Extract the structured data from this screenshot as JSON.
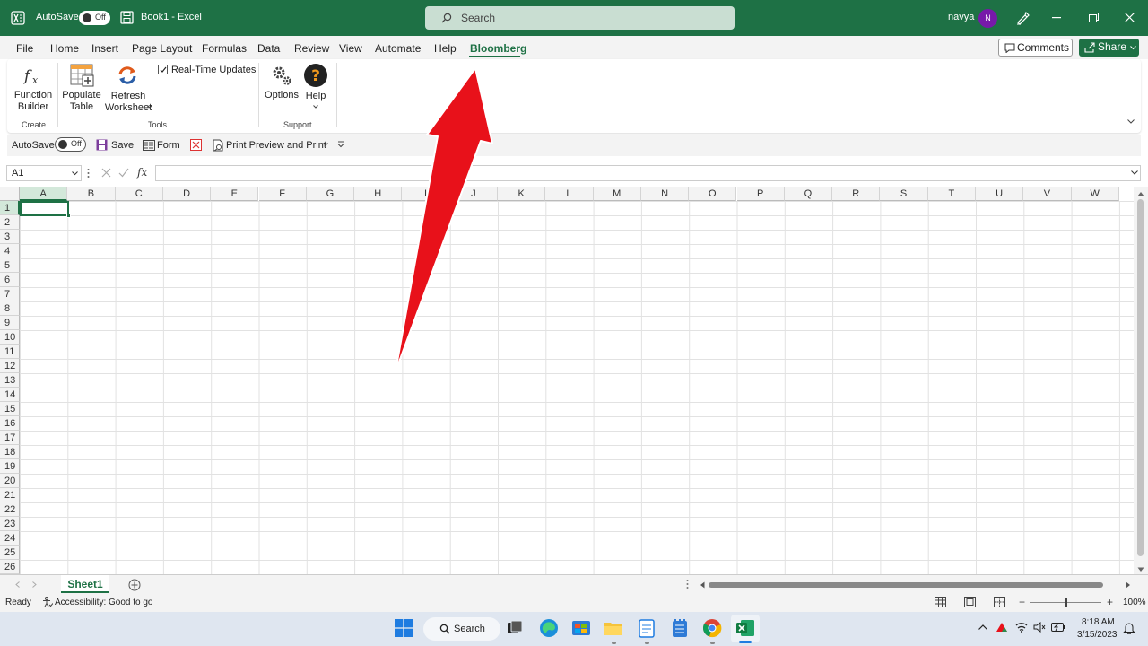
{
  "titlebar": {
    "autosave_label": "AutoSave",
    "autosave_state": "Off",
    "document_title": "Book1  -  Excel",
    "search_placeholder": "Search",
    "user_name": "navya",
    "user_initial": "N"
  },
  "menu": {
    "tabs": [
      "File",
      "Home",
      "Insert",
      "Page Layout",
      "Formulas",
      "Data",
      "Review",
      "View",
      "Automate",
      "Help",
      "Bloomberg"
    ],
    "active_tab": "Bloomberg",
    "comments_label": "Comments",
    "share_label": "Share"
  },
  "ribbon": {
    "function_builder": "Function Builder",
    "populate_table": "Populate Table",
    "refresh_worksheet": "Refresh Worksheet",
    "realtime_updates": "Real-Time Updates",
    "options": "Options",
    "help": "Help",
    "group_create": "Create",
    "group_tools": "Tools",
    "group_support": "Support"
  },
  "qat": {
    "autosave_label": "AutoSave",
    "autosave_state": "Off",
    "save_label": "Save",
    "form_label": "Form",
    "print_label": "Print Preview and Print"
  },
  "formula": {
    "name_box": "A1",
    "fx_label": "fx",
    "value": ""
  },
  "grid": {
    "columns": [
      "A",
      "B",
      "C",
      "D",
      "E",
      "F",
      "G",
      "H",
      "I",
      "J",
      "K",
      "L",
      "M",
      "N",
      "O",
      "P",
      "Q",
      "R",
      "S",
      "T",
      "U",
      "V",
      "W"
    ],
    "rows": [
      "1",
      "2",
      "3",
      "4",
      "5",
      "6",
      "7",
      "8",
      "9",
      "10",
      "11",
      "12",
      "13",
      "14",
      "15",
      "16",
      "17",
      "18",
      "19",
      "20",
      "21",
      "22",
      "23",
      "24",
      "25",
      "26"
    ],
    "selected_cell": "A1"
  },
  "sheets": {
    "tabs": [
      "Sheet1"
    ],
    "active": "Sheet1"
  },
  "status": {
    "ready": "Ready",
    "accessibility": "Accessibility: Good to go",
    "zoom": "100%"
  },
  "taskbar": {
    "search_label": "Search",
    "time": "8:18 AM",
    "date": "3/15/2023"
  },
  "colors": {
    "excel_green": "#1e7145",
    "arrow_red": "#e8111a",
    "avatar_purple": "#7719aa"
  }
}
